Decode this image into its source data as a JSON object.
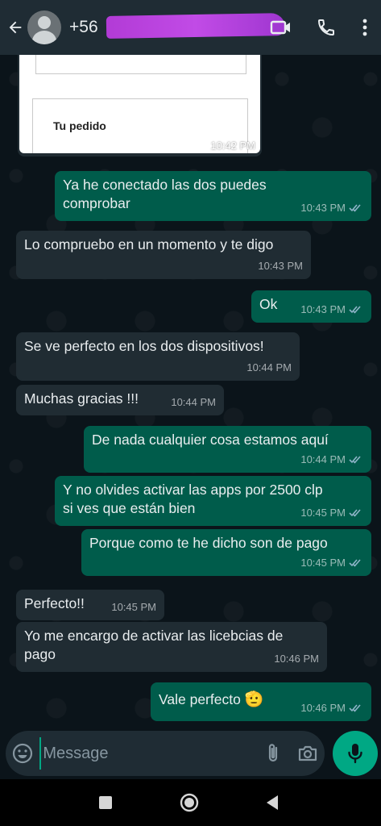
{
  "header": {
    "contact_name": "+56",
    "back_icon": "arrow-left-icon",
    "video_icon": "video-call-icon",
    "call_icon": "phone-icon",
    "more_icon": "more-vertical-icon"
  },
  "order_card": {
    "label": "Tu pedido",
    "time": "10:42 PM"
  },
  "messages": [
    {
      "dir": "out",
      "text": "Ya he conectado las dos puedes\ncomprobar",
      "time": "10:43 PM",
      "read": true
    },
    {
      "dir": "in",
      "text": "Lo compruebo en un momento y te digo",
      "time": "10:43 PM"
    },
    {
      "dir": "out",
      "text": "Ok",
      "time": "10:43 PM",
      "read": true
    },
    {
      "dir": "in",
      "text": "Se ve perfecto en los dos dispositivos!",
      "time": "10:44 PM"
    },
    {
      "dir": "in",
      "text": "Muchas gracias !!!",
      "time": "10:44 PM"
    },
    {
      "dir": "out",
      "text": "De nada cualquier cosa estamos aquí",
      "time": "10:44 PM",
      "read": true
    },
    {
      "dir": "out",
      "text": "Y no olvides activar las apps por 2500 clp\nsi ves que están bien",
      "time": "10:45 PM",
      "read": true
    },
    {
      "dir": "out",
      "text": "Porque como te he dicho son de pago",
      "time": "10:45 PM",
      "read": true
    },
    {
      "dir": "in",
      "text": "Perfecto!!",
      "time": "10:45 PM"
    },
    {
      "dir": "in",
      "text": "Yo me encargo de activar las licebcias de\npago",
      "time": "10:46 PM"
    },
    {
      "dir": "out",
      "text": "Vale perfecto",
      "emoji": "🫡",
      "time": "10:46 PM",
      "read": true
    }
  ],
  "input": {
    "placeholder": "Message",
    "value": ""
  },
  "colors": {
    "incoming": "#202c33",
    "outgoing": "#005c4b",
    "accent": "#00a884",
    "read_ticks": "#8fb4c8"
  }
}
